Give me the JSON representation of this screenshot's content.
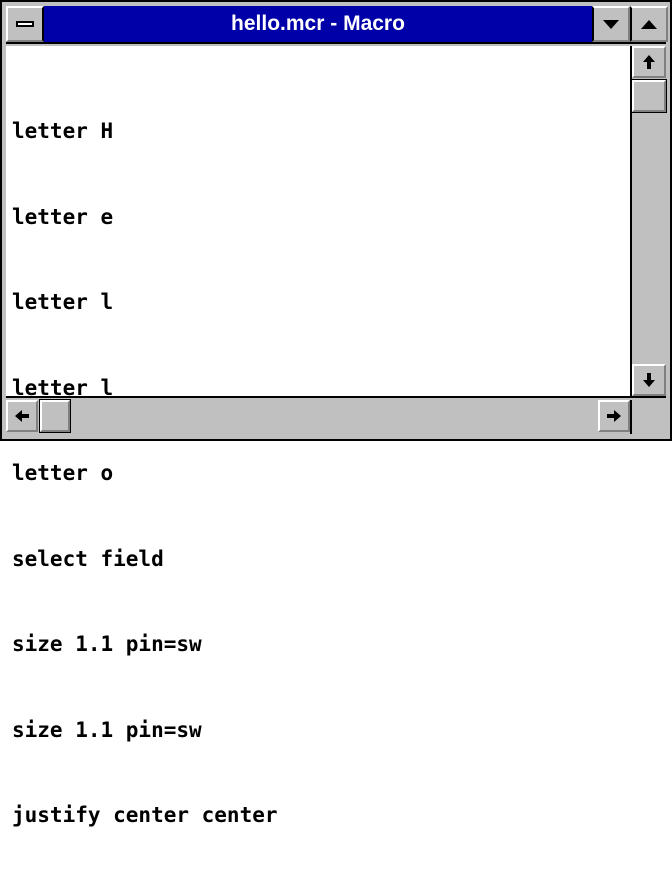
{
  "window": {
    "title": "hello.mcr - Macro",
    "colors": {
      "titlebar": "#0000a8",
      "frame": "#c0c0c0",
      "text": "#000000",
      "background": "#ffffff"
    }
  },
  "icons": {
    "system_menu": "system-menu-icon",
    "minimize": "triangle-down-icon",
    "maximize": "triangle-up-icon",
    "scroll_up": "arrow-up-icon",
    "scroll_down": "arrow-down-icon",
    "scroll_left": "arrow-left-icon",
    "scroll_right": "arrow-right-icon"
  },
  "editor": {
    "lines": [
      "letter H",
      "letter e",
      "letter l",
      "letter l",
      "letter o",
      "select field",
      "size 1.1 pin=sw",
      "size 1.1 pin=sw",
      "justify center center"
    ]
  }
}
